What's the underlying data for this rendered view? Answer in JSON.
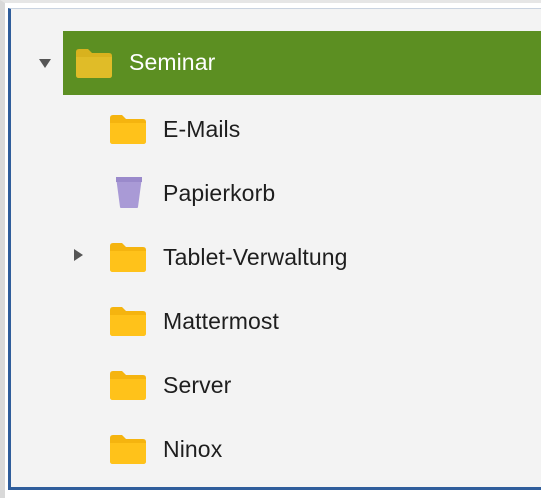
{
  "tree": {
    "root": {
      "label": "Seminar",
      "icon": "folder-icon",
      "expanded": true,
      "selected": true
    },
    "items": [
      {
        "label": "E-Mails",
        "icon": "folder-icon",
        "expandable": false
      },
      {
        "label": "Papierkorb",
        "icon": "trash-icon",
        "expandable": false
      },
      {
        "label": "Tablet-Verwaltung",
        "icon": "folder-icon",
        "expandable": true,
        "expanded": false
      },
      {
        "label": "Mattermost",
        "icon": "folder-icon",
        "expandable": false
      },
      {
        "label": "Server",
        "icon": "folder-icon",
        "expandable": false
      },
      {
        "label": "Ninox",
        "icon": "folder-icon",
        "expandable": false
      }
    ]
  },
  "colors": {
    "selection": "#5c8f22",
    "folder": "#ffc21a",
    "folder_selected": "#d8b21e",
    "trash": "#a99ad6",
    "panel_border": "#2f5d9b"
  }
}
